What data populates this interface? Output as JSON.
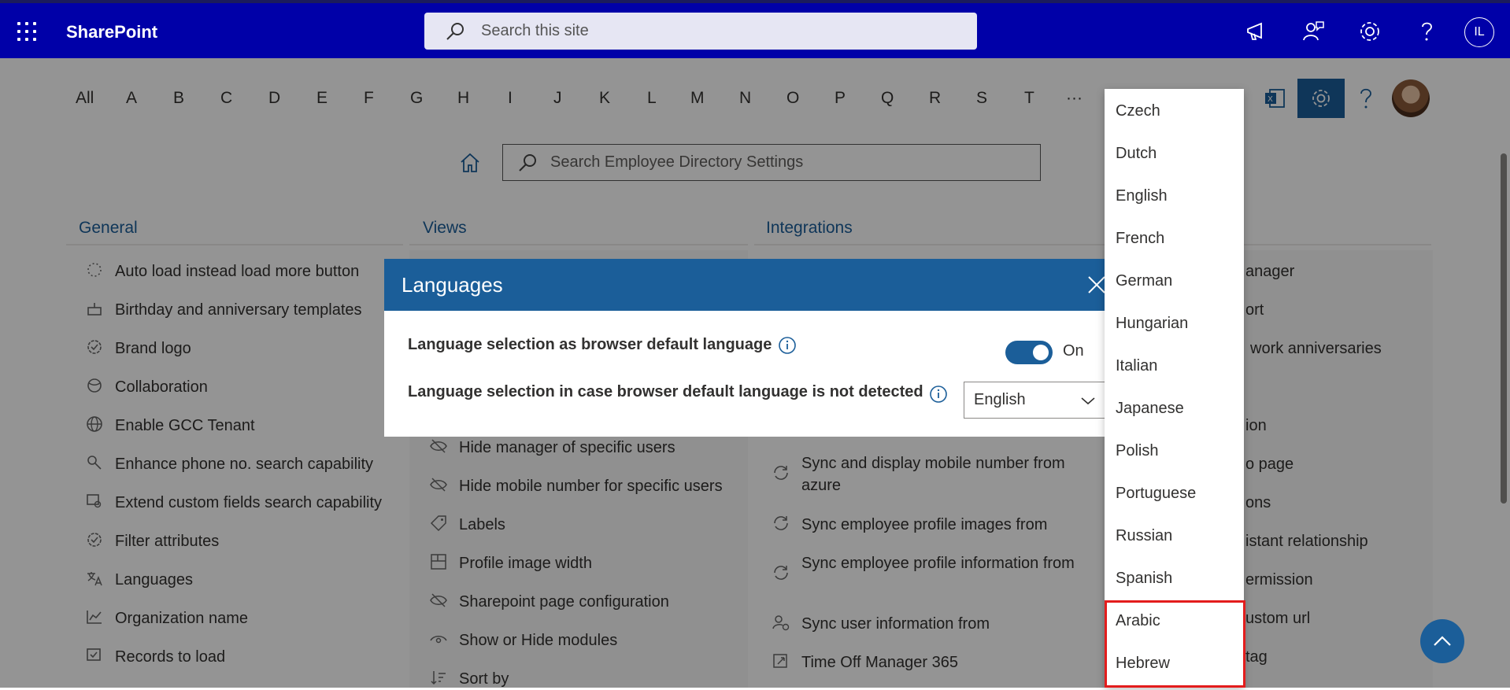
{
  "topbar": {
    "app_name": "SharePoint",
    "search_placeholder": "Search this site",
    "user_initials": "IL"
  },
  "alphabet": [
    "All",
    "A",
    "B",
    "C",
    "D",
    "E",
    "F",
    "G",
    "H",
    "I",
    "J",
    "K",
    "L",
    "M",
    "N",
    "O",
    "P",
    "Q",
    "R",
    "S",
    "T",
    "···"
  ],
  "settings_search": {
    "placeholder": "Search Employee Directory Settings"
  },
  "columns": {
    "general": {
      "title": "General",
      "items": [
        "Auto load instead load more button",
        "Birthday and anniversary templates",
        "Brand logo",
        "Collaboration",
        "Enable GCC Tenant",
        "Enhance phone no. search capability",
        "Extend custom fields search capability",
        "Filter attributes",
        "Languages",
        "Organization name",
        "Records to load"
      ]
    },
    "views": {
      "title": "Views",
      "items": [
        "Hide manager of specific users",
        "Hide mobile number for specific users",
        "Labels",
        "Profile image width",
        "Sharepoint page configuration",
        "Show or Hide modules",
        "Sort by"
      ]
    },
    "integrations": {
      "title": "Integrations",
      "items": [
        "Sync and display mobile number from azure",
        "Sync employee profile images from",
        "Sync employee profile information from",
        "Sync user information from",
        "Time Off Manager 365"
      ]
    },
    "right_partial": [
      "anager",
      "ort",
      "work anniversaries",
      "ion",
      "o page",
      "ons",
      "istant relationship",
      "ermission",
      "ustom url",
      "tag"
    ]
  },
  "dialog": {
    "title": "Languages",
    "row1_label": "Language selection as browser default language",
    "toggle_state": "On",
    "row2_label": "Language selection in case browser default language is not detected",
    "selected_language": "English"
  },
  "language_options": [
    "Czech",
    "Dutch",
    "English",
    "French",
    "German",
    "Hungarian",
    "Italian",
    "Japanese",
    "Polish",
    "Portuguese",
    "Russian",
    "Spanish",
    "Arabic",
    "Hebrew"
  ]
}
